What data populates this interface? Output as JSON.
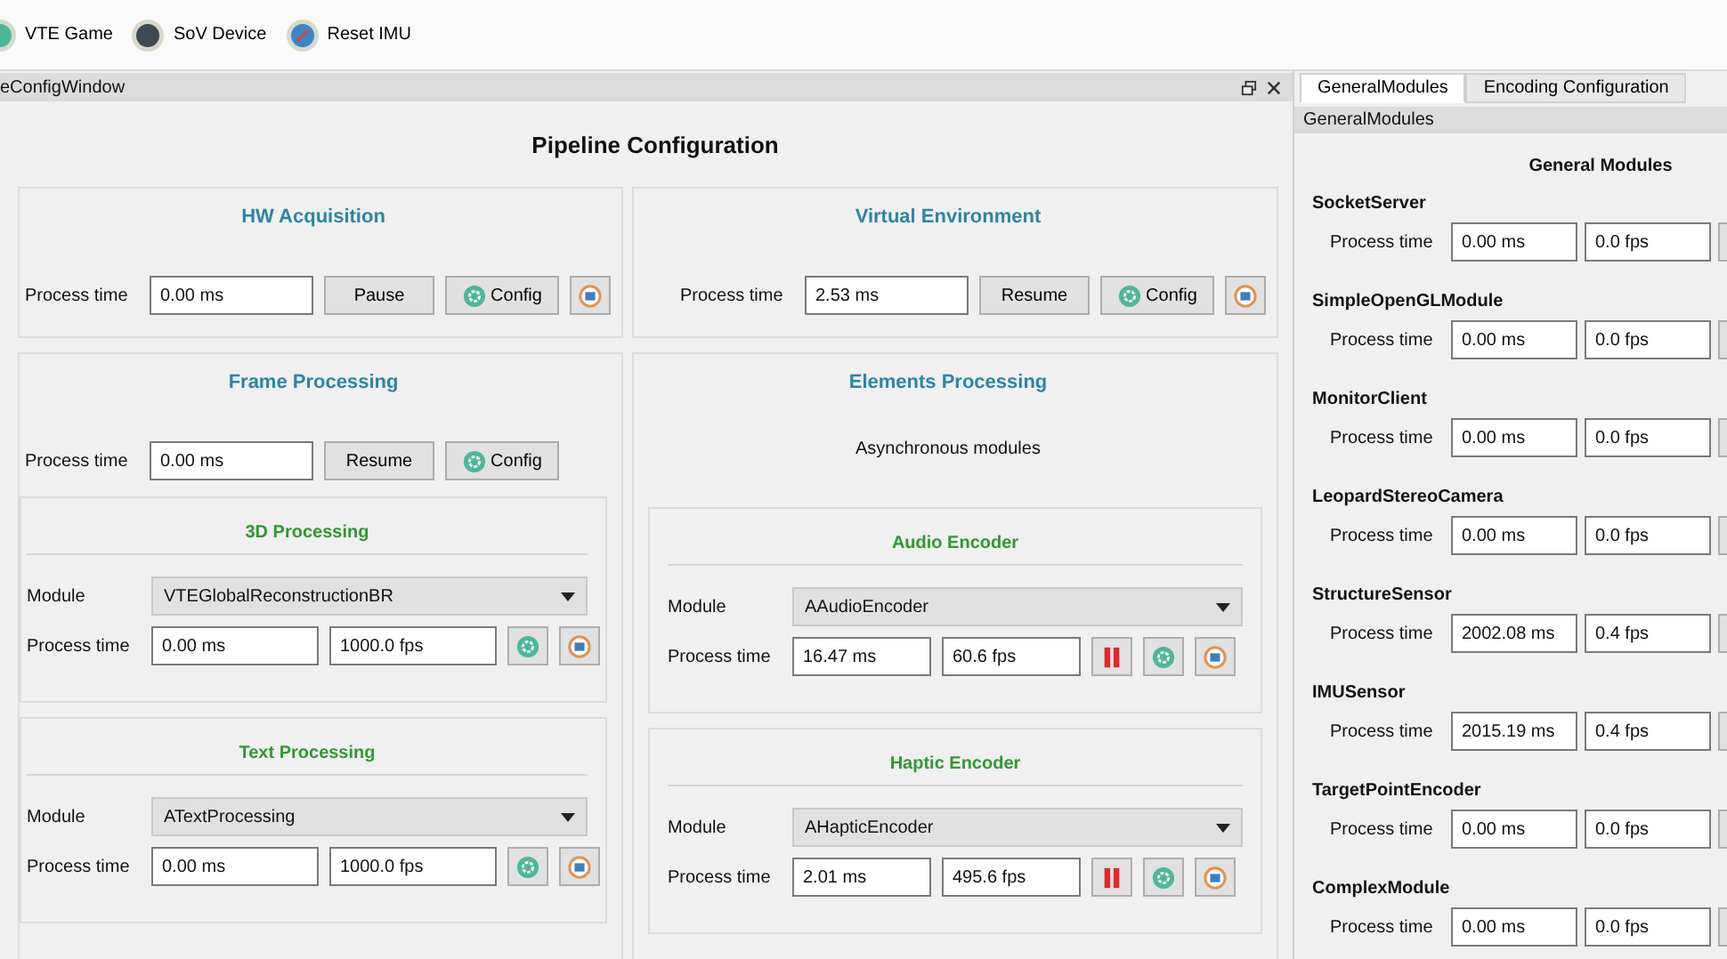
{
  "toolbar": [
    {
      "label": "VTE Game"
    },
    {
      "label": "SoV Device"
    },
    {
      "label": "Reset IMU"
    }
  ],
  "dock": {
    "title": "eConfigWindow",
    "heading": "Pipeline Configuration",
    "stages": [
      {
        "title": "HW Acquisition",
        "label": "Process time",
        "time": "0.00 ms",
        "buttons": [
          {
            "kind": "text",
            "label": "Pause"
          },
          {
            "kind": "config",
            "label": "Config"
          },
          {
            "kind": "image"
          }
        ]
      },
      {
        "title": "Virtual Environment",
        "label": "Process time",
        "time": "2.53 ms",
        "buttons": [
          {
            "kind": "text",
            "label": "Resume"
          },
          {
            "kind": "config",
            "label": "Config"
          },
          {
            "kind": "image"
          }
        ]
      },
      {
        "title": "Frame Processing",
        "label": "Process time",
        "time": "0.00 ms",
        "buttons": [
          {
            "kind": "text",
            "label": "Resume"
          },
          {
            "kind": "config",
            "label": "Config"
          }
        ],
        "groups": [
          {
            "title": "3D Processing",
            "module_label": "Module",
            "module": "VTEGlobalReconstructionBR",
            "label": "Process time",
            "time": "0.00 ms",
            "fps": "1000.0 fps",
            "buttons": [
              {
                "kind": "gear"
              },
              {
                "kind": "image"
              }
            ]
          },
          {
            "title": "Text Processing",
            "module_label": "Module",
            "module": "ATextProcessing",
            "label": "Process time",
            "time": "0.00 ms",
            "fps": "1000.0 fps",
            "buttons": [
              {
                "kind": "gear"
              },
              {
                "kind": "image"
              }
            ]
          }
        ]
      },
      {
        "title": "Elements Processing",
        "note": "Asynchronous modules",
        "groups": [
          {
            "title": "Audio Encoder",
            "module_label": "Module",
            "module": "AAudioEncoder",
            "label": "Process time",
            "time": "16.47 ms",
            "fps": "60.6 fps",
            "buttons": [
              {
                "kind": "pause"
              },
              {
                "kind": "gear"
              },
              {
                "kind": "image"
              }
            ]
          },
          {
            "title": "Haptic Encoder",
            "module_label": "Module",
            "module": "AHapticEncoder",
            "label": "Process time",
            "time": "2.01 ms",
            "fps": "495.6 fps",
            "buttons": [
              {
                "kind": "pause"
              },
              {
                "kind": "gear"
              },
              {
                "kind": "image"
              }
            ]
          }
        ]
      }
    ]
  },
  "side": {
    "tabs": [
      {
        "label": "GeneralModules",
        "selected": true
      },
      {
        "label": "Encoding Configuration",
        "selected": false
      }
    ],
    "panel_title": "GeneralModules",
    "heading": "General Modules",
    "modules": [
      {
        "name": "SocketServer",
        "label": "Process time",
        "time": "0.00 ms",
        "fps": "0.0 fps"
      },
      {
        "name": "SimpleOpenGLModule",
        "label": "Process time",
        "time": "0.00 ms",
        "fps": "0.0 fps"
      },
      {
        "name": "MonitorClient",
        "label": "Process time",
        "time": "0.00 ms",
        "fps": "0.0 fps"
      },
      {
        "name": "LeopardStereoCamera",
        "label": "Process time",
        "time": "0.00 ms",
        "fps": "0.0 fps"
      },
      {
        "name": "StructureSensor",
        "label": "Process time",
        "time": "2002.08 ms",
        "fps": "0.4 fps"
      },
      {
        "name": "IMUSensor",
        "label": "Process time",
        "time": "2015.19 ms",
        "fps": "0.4 fps"
      },
      {
        "name": "TargetPointEncoder",
        "label": "Process time",
        "time": "0.00 ms",
        "fps": "0.0 fps"
      },
      {
        "name": "ComplexModule",
        "label": "Process time",
        "time": "0.00 ms",
        "fps": "0.0 fps"
      }
    ]
  }
}
